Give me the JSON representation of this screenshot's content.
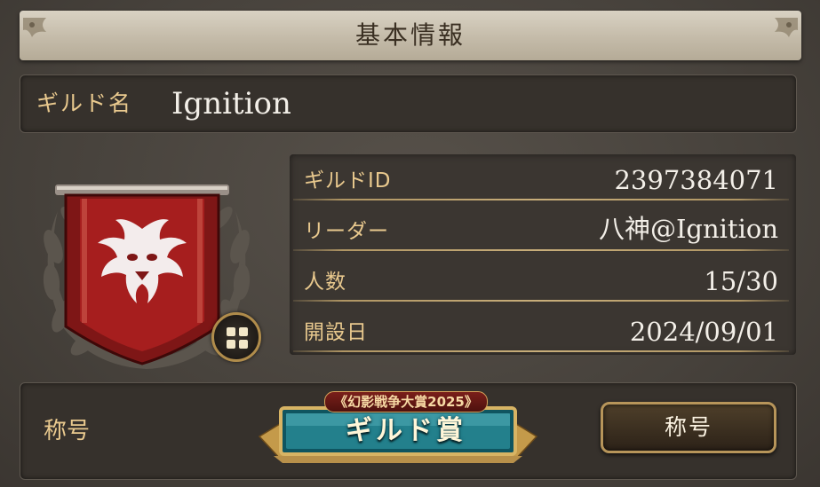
{
  "header": {
    "title": "基本情報"
  },
  "guild_name": {
    "label": "ギルド名",
    "value": "Ignition"
  },
  "details": [
    {
      "label": "ギルドID",
      "value": "2397384071"
    },
    {
      "label": "リーダー",
      "value": "八神@Ignition"
    },
    {
      "label": "人数",
      "value": "15/30"
    },
    {
      "label": "開設日",
      "value": "2024/09/01"
    }
  ],
  "emblem": {
    "icon": "demon-crest-banner-icon",
    "toggle_icon": "grid-icon"
  },
  "title_section": {
    "label": "称号",
    "award_subtitle": "《幻影戦争大賞2025》",
    "award_name": "ギルド賞",
    "button_label": "称号"
  },
  "colors": {
    "label_gold": "#e9c98e",
    "value_white": "#f3efe8",
    "panel_dark": "#36312c",
    "banner_red": "#8e1a1a"
  }
}
